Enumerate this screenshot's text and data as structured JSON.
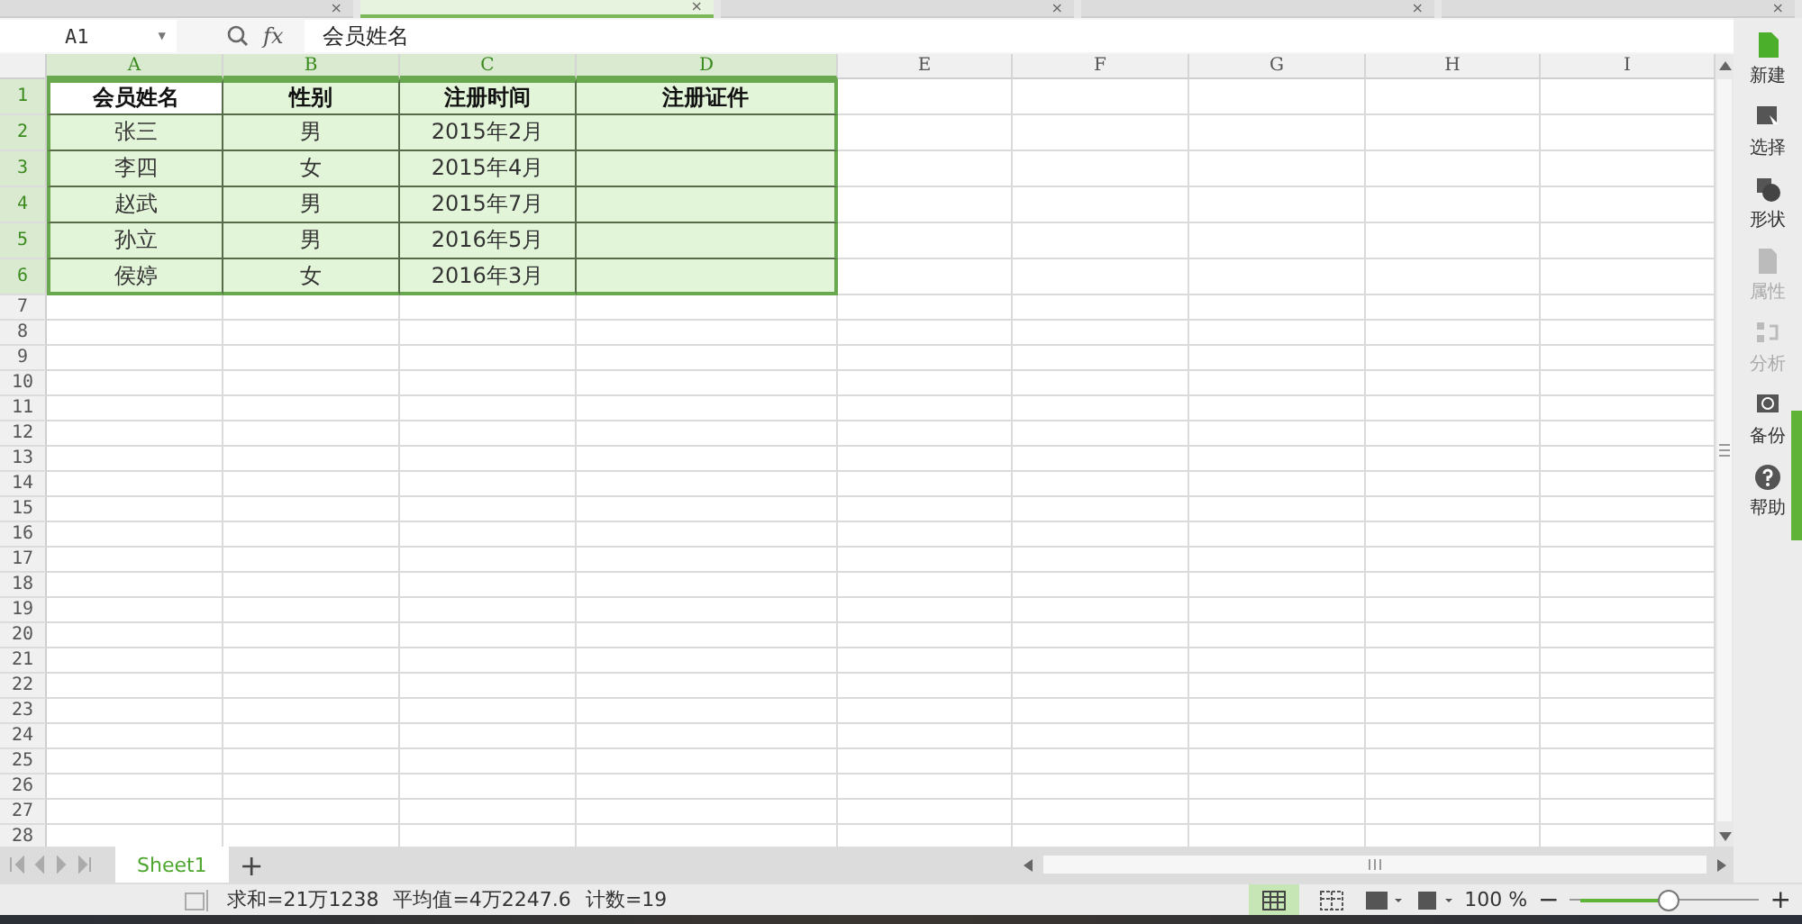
{
  "tab_strip": {
    "tabs": [
      {
        "close": "×",
        "selected": false
      },
      {
        "close": "×",
        "selected": true
      },
      {
        "close": "×",
        "selected": false
      },
      {
        "close": "×",
        "selected": false
      },
      {
        "close": "×",
        "selected": false
      }
    ]
  },
  "formula_bar": {
    "name_box": "A1",
    "name_box_caret": "▼",
    "fx": "fx",
    "value": "会员姓名"
  },
  "columns": [
    {
      "label": "A",
      "selected": true
    },
    {
      "label": "B",
      "selected": true
    },
    {
      "label": "C",
      "selected": true
    },
    {
      "label": "D",
      "selected": true
    },
    {
      "label": "E",
      "selected": false
    },
    {
      "label": "F",
      "selected": false
    },
    {
      "label": "G",
      "selected": false
    },
    {
      "label": "H",
      "selected": false
    },
    {
      "label": "I",
      "selected": false
    }
  ],
  "rows": [
    {
      "label": "1",
      "selected": true,
      "header": true,
      "cells": [
        {
          "text": "会员姓名",
          "active": true
        },
        {
          "text": "性别",
          "active": false
        },
        {
          "text": "注册时间",
          "active": false
        },
        {
          "text": "注册证件",
          "active": false
        }
      ]
    },
    {
      "label": "2",
      "selected": true,
      "header": false,
      "cells": [
        {
          "text": "张三",
          "active": false
        },
        {
          "text": "男",
          "active": false
        },
        {
          "text": "2015年2月",
          "active": false
        },
        {
          "active": false
        }
      ]
    },
    {
      "label": "3",
      "selected": true,
      "header": false,
      "cells": [
        {
          "text": "李四",
          "active": false
        },
        {
          "text": "女",
          "active": false
        },
        {
          "text": "2015年4月",
          "active": false
        },
        {
          "active": false
        }
      ]
    },
    {
      "label": "4",
      "selected": true,
      "header": false,
      "cells": [
        {
          "text": "赵武",
          "active": false
        },
        {
          "text": "男",
          "active": false
        },
        {
          "text": "2015年7月",
          "active": false
        },
        {
          "active": false
        }
      ]
    },
    {
      "label": "5",
      "selected": true,
      "header": false,
      "cells": [
        {
          "text": "孙立",
          "active": false
        },
        {
          "text": "男",
          "active": false
        },
        {
          "text": "2016年5月",
          "active": false
        },
        {
          "active": false
        }
      ]
    },
    {
      "label": "6",
      "selected": true,
      "header": false,
      "cells": [
        {
          "text": "侯婷",
          "active": false
        },
        {
          "text": "女",
          "active": false
        },
        {
          "text": "2016年3月",
          "active": false
        },
        {
          "active": false
        }
      ]
    },
    {
      "label": "7",
      "selected": false
    },
    {
      "label": "8",
      "selected": false
    },
    {
      "label": "9",
      "selected": false
    },
    {
      "label": "10",
      "selected": false
    },
    {
      "label": "11",
      "selected": false
    },
    {
      "label": "12",
      "selected": false
    },
    {
      "label": "13",
      "selected": false
    },
    {
      "label": "14",
      "selected": false
    },
    {
      "label": "15",
      "selected": false
    },
    {
      "label": "16",
      "selected": false
    },
    {
      "label": "17",
      "selected": false
    },
    {
      "label": "18",
      "selected": false
    },
    {
      "label": "19",
      "selected": false
    },
    {
      "label": "20",
      "selected": false
    },
    {
      "label": "21",
      "selected": false
    },
    {
      "label": "22",
      "selected": false
    },
    {
      "label": "23",
      "selected": false
    },
    {
      "label": "24",
      "selected": false
    },
    {
      "label": "25",
      "selected": false
    },
    {
      "label": "26",
      "selected": false
    },
    {
      "label": "27",
      "selected": false
    },
    {
      "label": "28",
      "selected": false
    }
  ],
  "side_panel": [
    {
      "kind": "new",
      "label": "新建",
      "disabled": false
    },
    {
      "kind": "select",
      "label": "选择",
      "disabled": false
    },
    {
      "kind": "shape",
      "label": "形状",
      "disabled": false
    },
    {
      "kind": "property",
      "label": "属性",
      "disabled": true
    },
    {
      "kind": "analyze",
      "label": "分析",
      "disabled": true
    },
    {
      "kind": "backup",
      "label": "备份",
      "disabled": false
    },
    {
      "kind": "help",
      "label": "帮助",
      "disabled": false
    }
  ],
  "sheet_tabs": {
    "tabs": [
      {
        "label": "Sheet1",
        "selected": true
      }
    ],
    "add": "+"
  },
  "status_bar": {
    "stats": [
      "求和=21万1238",
      "平均值=4万2247.6",
      "计数=19"
    ],
    "views": [
      {
        "kind": "normal",
        "selected": true
      },
      {
        "kind": "page",
        "selected": false
      }
    ],
    "zoom": "100 %",
    "zoom_out": "−",
    "zoom_in": "+",
    "zoom_slider": {
      "level": 0.52
    }
  }
}
